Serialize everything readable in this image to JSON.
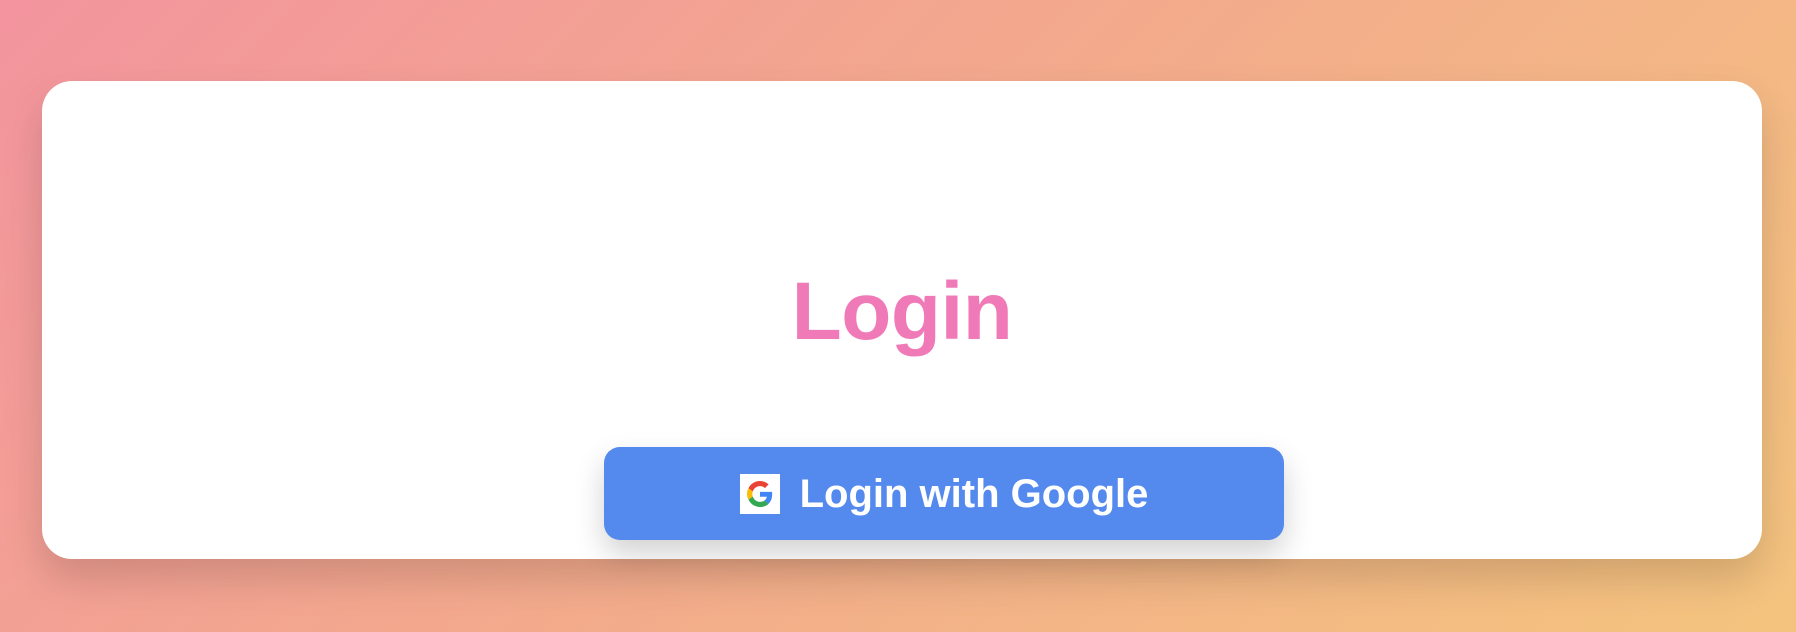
{
  "page": {
    "background_gradient": [
      "#f3949e",
      "#f3a98d",
      "#f4c47e"
    ]
  },
  "card": {
    "title": "Login",
    "title_color": "#f07ab8"
  },
  "login_button": {
    "label": "Login with Google",
    "icon": "google-icon",
    "background": "#5489ee",
    "text_color": "#ffffff"
  }
}
